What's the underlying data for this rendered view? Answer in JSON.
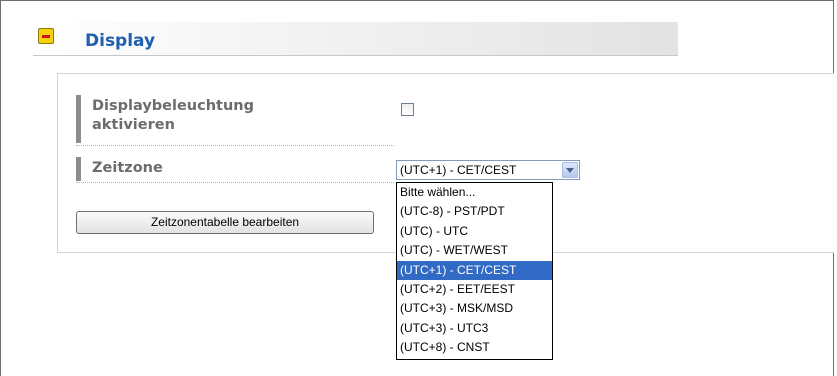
{
  "section": {
    "title": "Display",
    "collapse_icon": "minus-box-icon"
  },
  "form": {
    "backlight": {
      "label": "Displaybeleuchtung aktivieren",
      "label_line1": "Displaybeleuchtung",
      "label_line2": "aktivieren",
      "checked": false
    },
    "timezone": {
      "label": "Zeitzone",
      "selected": "(UTC+1) - CET/CEST",
      "options": [
        "Bitte wählen...",
        "(UTC-8) - PST/PDT",
        "(UTC) - UTC",
        "(UTC) - WET/WEST",
        "(UTC+1) - CET/CEST",
        "(UTC+2) - EET/EEST",
        "(UTC+3) - MSK/MSD",
        "(UTC+3) - UTC3",
        "(UTC+8) - CNST"
      ],
      "highlighted_index": 4
    },
    "edit_button_label": "Zeitzonentabelle bearbeiten"
  },
  "colors": {
    "title": "#1f5fb0",
    "highlight": "#316ac5",
    "label": "#6c6c6c"
  }
}
